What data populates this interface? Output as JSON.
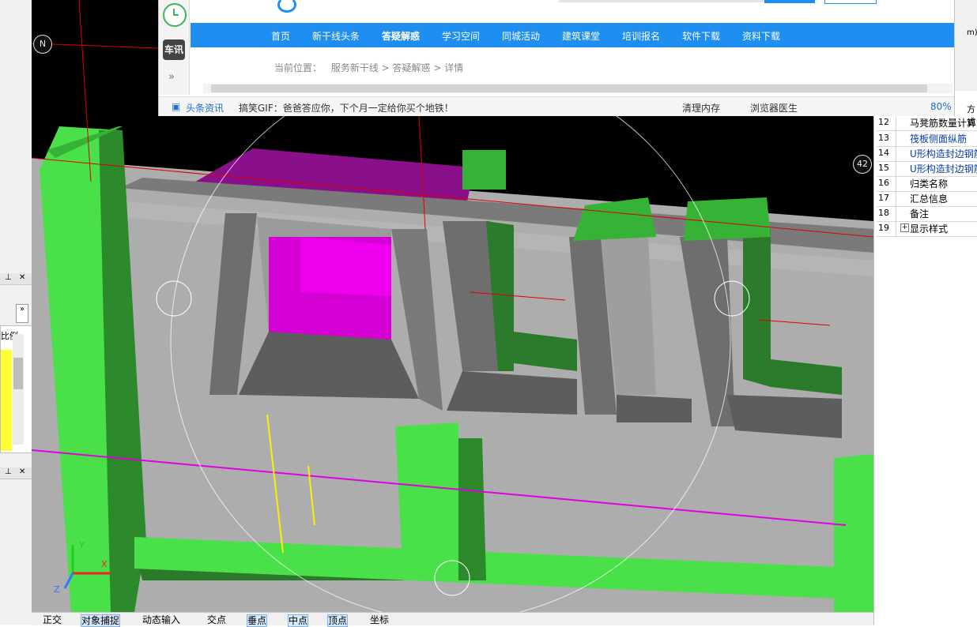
{
  "browser": {
    "nav": [
      "首页",
      "新干线头条",
      "答疑解惑",
      "学习空间",
      "同城活动",
      "建筑课堂",
      "培训报名",
      "软件下载",
      "资料下载"
    ],
    "active_nav": "答疑解惑",
    "breadcrumb_label": "当前位置：",
    "breadcrumb": "服务新干线 > 答疑解惑 > 详情",
    "side_badge": "车讯",
    "side_more": "»",
    "status": {
      "news": "头条资讯",
      "headline": "搞笑GIF：爸爸答应你，下个月一定给你买个地铁！",
      "clean_mem": "清理内存",
      "doctor": "浏览器医生",
      "zoom": "80%"
    }
  },
  "viewport": {
    "north": "N",
    "axis_badge": "42",
    "axis_x": "X",
    "axis_y": "Y",
    "axis_z": "Z"
  },
  "properties": {
    "partial_top": "m)",
    "partial_fragment": "方式",
    "rows": [
      {
        "n": "12",
        "label": "马凳筋数量计算方",
        "blue": false
      },
      {
        "n": "13",
        "label": "筏板侧面纵筋",
        "blue": true
      },
      {
        "n": "14",
        "label": "U形构造封边钢筋",
        "blue": true
      },
      {
        "n": "15",
        "label": "U形构造封边钢筋",
        "blue": true
      },
      {
        "n": "16",
        "label": "归类名称",
        "blue": false
      },
      {
        "n": "17",
        "label": "汇总信息",
        "blue": false
      },
      {
        "n": "18",
        "label": "备注",
        "blue": false
      },
      {
        "n": "19",
        "label": "显示样式",
        "blue": false
      }
    ]
  },
  "leftdock": {
    "partial_label": "比例"
  },
  "bottombar": [
    "正交",
    "对象捕捉",
    "动态输入",
    "交点",
    "垂点",
    "中点",
    "顶点",
    "坐标"
  ]
}
